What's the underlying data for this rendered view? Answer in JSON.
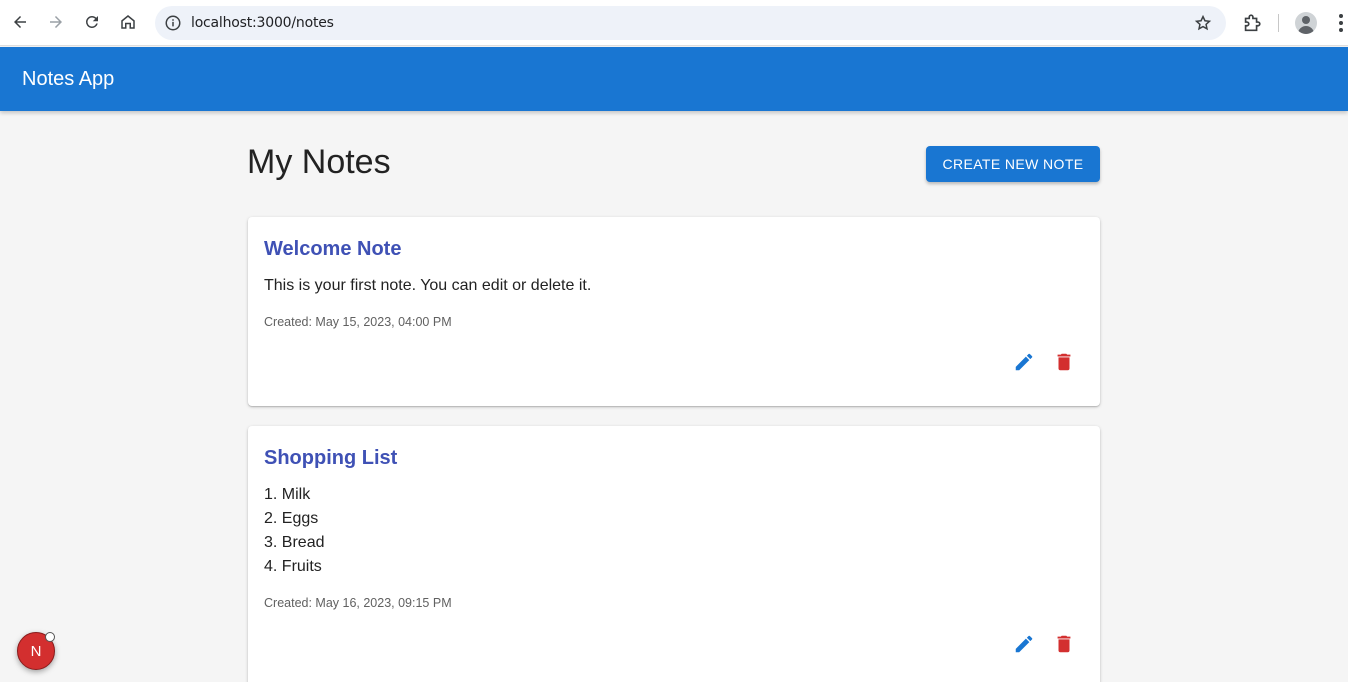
{
  "browser": {
    "url": "localhost:3000/notes",
    "icons": [
      "back-icon",
      "forward-icon",
      "reload-icon",
      "home-icon",
      "info-icon",
      "star-icon",
      "extensions-icon",
      "more-icon"
    ]
  },
  "app": {
    "title": "Notes App",
    "page_title": "My Notes",
    "create_button_label": "CREATE NEW NOTE"
  },
  "notes": [
    {
      "title": "Welcome Note",
      "body": [
        "This is your first note. You can edit or delete it."
      ],
      "created": "Created: May 15, 2023, 04:00 PM"
    },
    {
      "title": "Shopping List",
      "body": [
        "1. Milk",
        "2. Eggs",
        "3. Bread",
        "4. Fruits"
      ],
      "created": "Created: May 16, 2023, 09:15 PM"
    }
  ],
  "dev_badge": {
    "label": "N"
  },
  "colors": {
    "primary": "#1976d2",
    "note_title": "#3f51b5",
    "delete": "#d32f2f"
  }
}
